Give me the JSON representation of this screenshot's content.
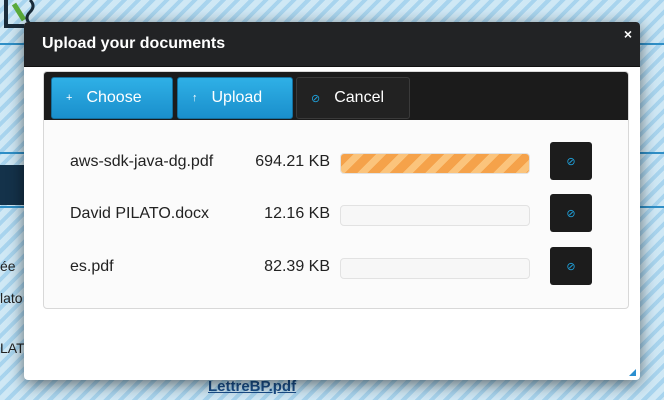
{
  "dialog": {
    "title": "Upload your documents",
    "close_glyph": "×"
  },
  "toolbar": {
    "choose": {
      "icon": "plus-icon",
      "glyph": "+",
      "label": "Choose"
    },
    "upload": {
      "icon": "upload-icon",
      "glyph": "↑",
      "label": "Upload"
    },
    "cancel": {
      "icon": "cancel-icon",
      "glyph": "⊘",
      "label": "Cancel"
    }
  },
  "files": [
    {
      "name": "aws-sdk-java-dg.pdf",
      "size": "694.21 KB",
      "progress": 1.0
    },
    {
      "name": "David PILATO.docx",
      "size": "12.16 KB",
      "progress": 0
    },
    {
      "name": "es.pdf",
      "size": "82.39 KB",
      "progress": 0
    }
  ],
  "row_cancel_glyph": "⊘",
  "background": {
    "link": "LettreBP.pdf",
    "fragments": [
      "ée",
      "lato",
      "LAT"
    ]
  },
  "colors": {
    "accent": "#1a8fcc",
    "progress": "#f5a24a",
    "titlebar": "#222325"
  }
}
